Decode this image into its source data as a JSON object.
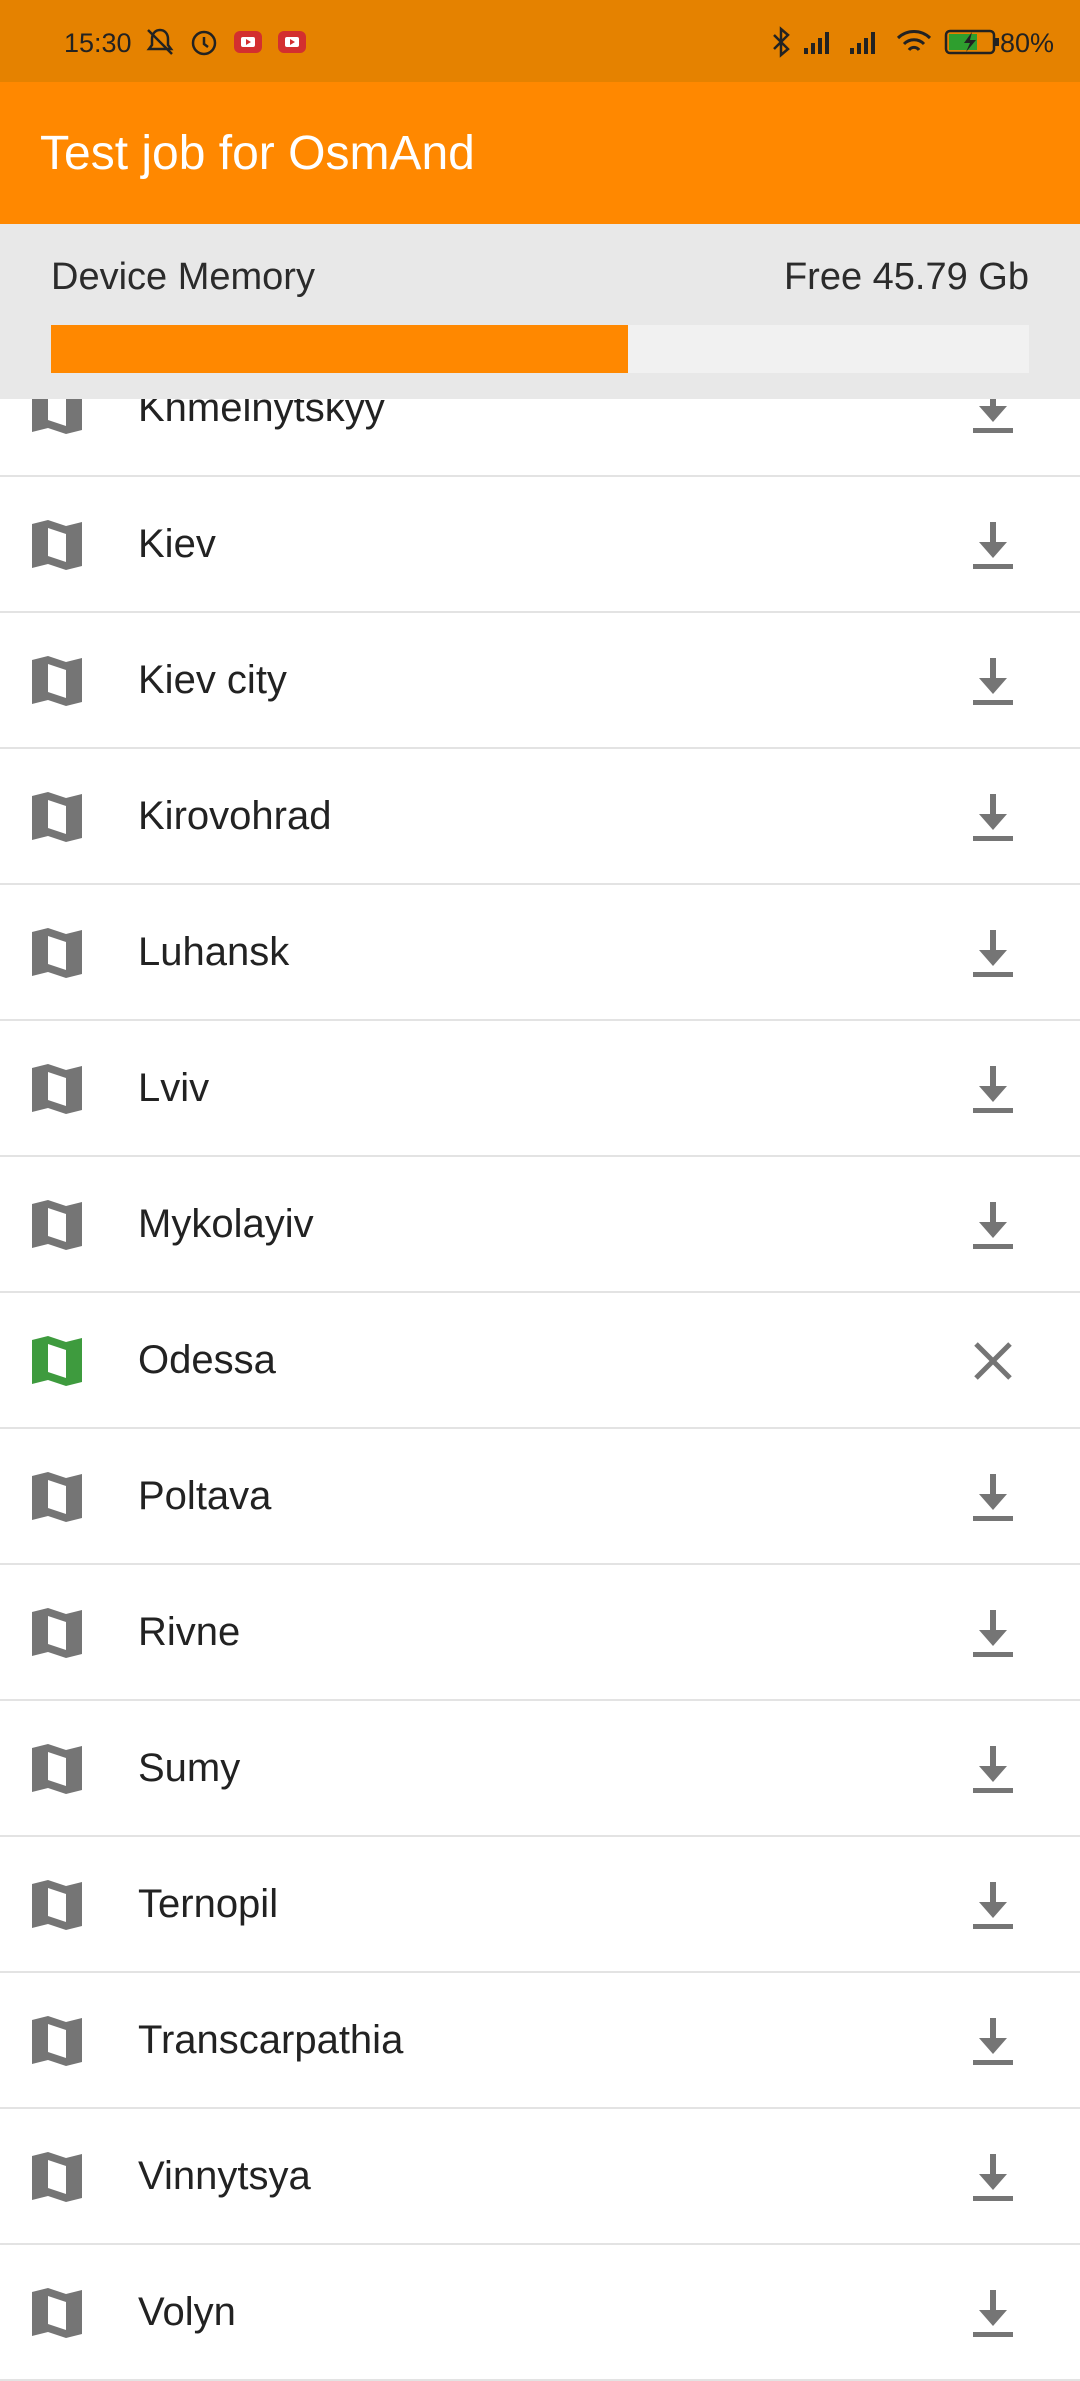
{
  "status_bar": {
    "time": "15:30",
    "battery": "80%",
    "icons": [
      "muted-bell-icon",
      "alarm-icon",
      "youtube-notification-icon",
      "youtube-notification-icon",
      "bluetooth-icon",
      "signal-icon",
      "signal-icon",
      "wifi-icon",
      "battery-charging-icon"
    ]
  },
  "app_bar": {
    "title": "Test job for OsmAnd"
  },
  "memory": {
    "label": "Device Memory",
    "free_text": "Free 45.79 Gb",
    "used_fraction": 0.59
  },
  "colors": {
    "accent": "#FF8800",
    "status_bar": "#E58200",
    "map_icon": "#757575",
    "downloaded_map_icon": "#3E9B3E"
  },
  "regions": [
    {
      "name": "Khmelnytskyy",
      "downloaded": false,
      "action": "download-icon"
    },
    {
      "name": "Kiev",
      "downloaded": false,
      "action": "download-icon"
    },
    {
      "name": "Kiev city",
      "downloaded": false,
      "action": "download-icon"
    },
    {
      "name": "Kirovohrad",
      "downloaded": false,
      "action": "download-icon"
    },
    {
      "name": "Luhansk",
      "downloaded": false,
      "action": "download-icon"
    },
    {
      "name": "Lviv",
      "downloaded": false,
      "action": "download-icon"
    },
    {
      "name": "Mykolayiv",
      "downloaded": false,
      "action": "download-icon"
    },
    {
      "name": "Odessa",
      "downloaded": true,
      "action": "close-icon"
    },
    {
      "name": "Poltava",
      "downloaded": false,
      "action": "download-icon"
    },
    {
      "name": "Rivne",
      "downloaded": false,
      "action": "download-icon"
    },
    {
      "name": "Sumy",
      "downloaded": false,
      "action": "download-icon"
    },
    {
      "name": "Ternopil",
      "downloaded": false,
      "action": "download-icon"
    },
    {
      "name": "Transcarpathia",
      "downloaded": false,
      "action": "download-icon"
    },
    {
      "name": "Vinnytsya",
      "downloaded": false,
      "action": "download-icon"
    },
    {
      "name": "Volyn",
      "downloaded": false,
      "action": "download-icon"
    }
  ]
}
